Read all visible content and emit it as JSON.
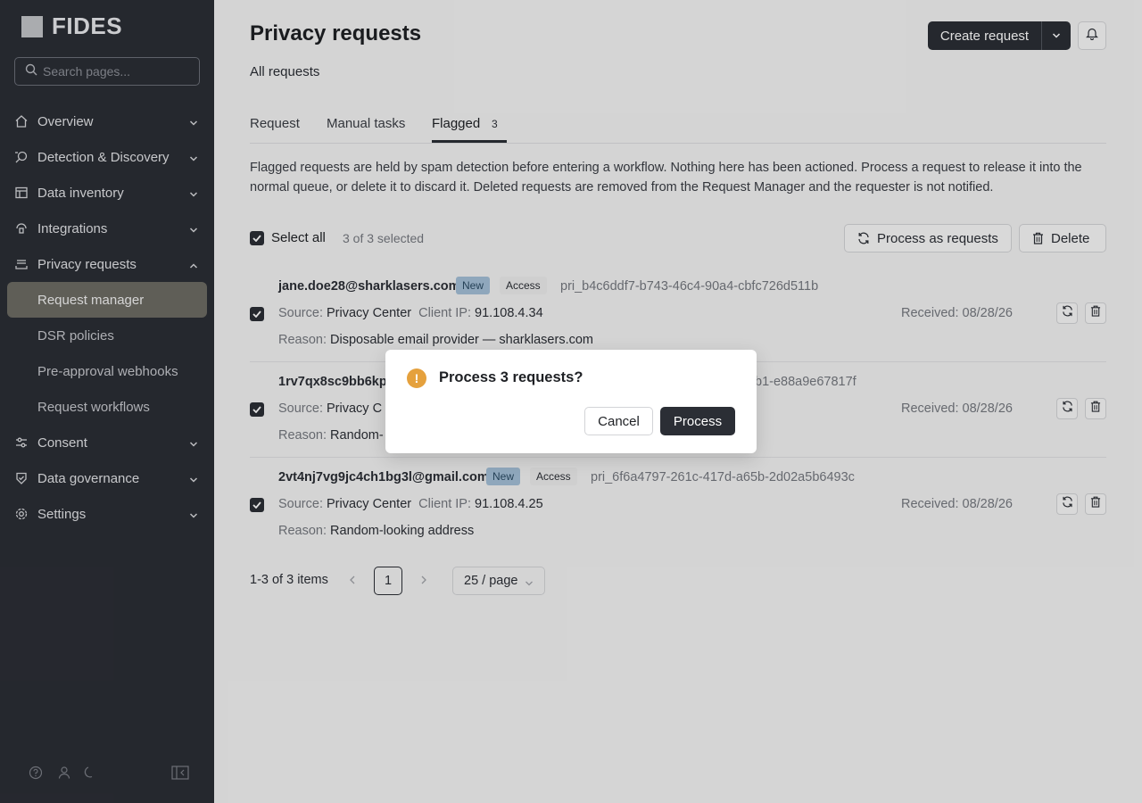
{
  "app": {
    "logo_text": "FIDES"
  },
  "sidebar": {
    "search_placeholder": "Search pages...",
    "nav": [
      {
        "label": "Overview",
        "icon": "home-icon"
      },
      {
        "label": "Detection & Discovery",
        "icon": "radar-search-icon"
      },
      {
        "label": "Data inventory",
        "icon": "table-icon"
      },
      {
        "label": "Integrations",
        "icon": "plug-icon"
      },
      {
        "label": "Privacy requests",
        "icon": "inbox-icon",
        "expanded": true
      }
    ],
    "sub_items": [
      {
        "label": "Request manager",
        "active": true
      },
      {
        "label": "DSR policies"
      },
      {
        "label": "Pre-approval webhooks"
      },
      {
        "label": "Request workflows"
      }
    ],
    "nav_after": [
      {
        "label": "Consent",
        "icon": "sliders-icon"
      },
      {
        "label": "Data governance",
        "icon": "shield-check-icon"
      },
      {
        "label": "Settings",
        "icon": "gear-icon"
      }
    ]
  },
  "header": {
    "title": "Privacy requests",
    "breadcrumb": "All requests",
    "create_label": "Create request"
  },
  "tabs": [
    {
      "label": "Request"
    },
    {
      "label": "Manual tasks"
    },
    {
      "label": "Flagged",
      "count": "3",
      "active": true
    }
  ],
  "info_text": "Flagged requests are held by spam detection before entering a workflow. Nothing here has been actioned. Process a request to release it into the normal queue, or delete it to discard it. Deleted requests are removed from the Request Manager and the requester is not notified.",
  "toolbar": {
    "select_all_label": "Select all",
    "selected_count": "3 of 3 selected",
    "process_label": "Process as requests",
    "delete_label": "Delete"
  },
  "labels": {
    "source": "Source:",
    "client_ip": "Client IP:",
    "reason": "Reason:",
    "received": "Received:"
  },
  "requests": [
    {
      "email": "jane.doe28@sharklasers.com",
      "status": "New",
      "type": "Access",
      "id": "pri_b4c6ddf7-b743-46c4-90a4-cbfc726d511b",
      "source": "Privacy Center",
      "client_ip": "91.108.4.34",
      "reason": "Disposable email provider — sharklasers.com",
      "received": "08/28/26"
    },
    {
      "email": "1rv7qx8sc9bb6kp5",
      "id_fragment": "b1-e88a9e67817f",
      "source": "Privacy C",
      "reason": "Random-",
      "received": "08/28/26"
    },
    {
      "email": "2vt4nj7vg9jc4ch1bg3l@gmail.com",
      "status": "New",
      "type": "Access",
      "id": "pri_6f6a4797-261c-417d-a65b-2d02a5b6493c",
      "source": "Privacy Center",
      "client_ip": "91.108.4.25",
      "reason": "Random-looking address",
      "received": "08/28/26"
    }
  ],
  "pagination": {
    "total": "1-3 of 3 items",
    "current_page": "1",
    "page_size": "25 / page"
  },
  "modal": {
    "title": "Process 3 requests?",
    "icon": "warning-icon",
    "cancel_label": "Cancel",
    "confirm_label": "Process"
  },
  "colors": {
    "sidebar_bg": "#2b2e35",
    "active_nav_bg": "#6d6b64",
    "primary_button": "#2b2e35",
    "badge_new_bg": "#a3bfd6",
    "warning": "#e5a13d"
  }
}
